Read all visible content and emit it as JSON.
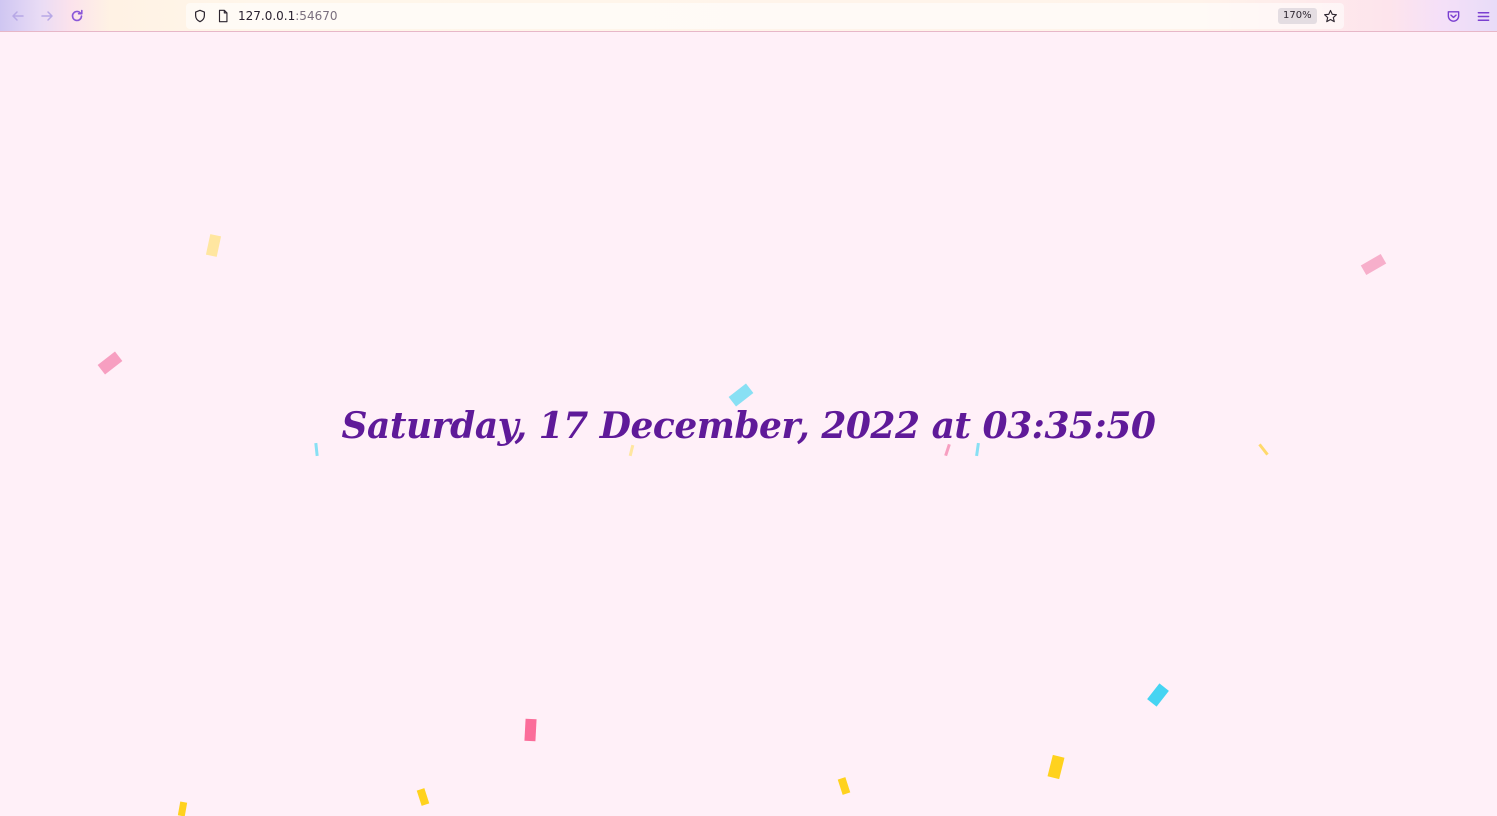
{
  "browser": {
    "url_host": "127.0.0.1",
    "url_port": ":54670",
    "zoom": "170%",
    "icons": {
      "back": "arrow-left-icon",
      "forward": "arrow-right-icon",
      "reload": "reload-icon",
      "tracking": "shield-icon",
      "page": "page-icon",
      "bookmark": "star-icon",
      "pocket": "pocket-icon",
      "menu": "hamburger-menu-icon"
    },
    "accent": "#8a57d8"
  },
  "main": {
    "datetime_text": "Saturday, 17 December, 2022 at 03:35:50",
    "text_color": "#5f1a99",
    "background": "#fff0f8"
  },
  "confetti_colors": {
    "pink": "#f79fc1",
    "hotpink": "#fb6d9a",
    "yellow": "#ffd21e",
    "paleyellow": "#ffe6a0",
    "blue": "#46d4f2",
    "lightblue": "#88e0f4"
  }
}
